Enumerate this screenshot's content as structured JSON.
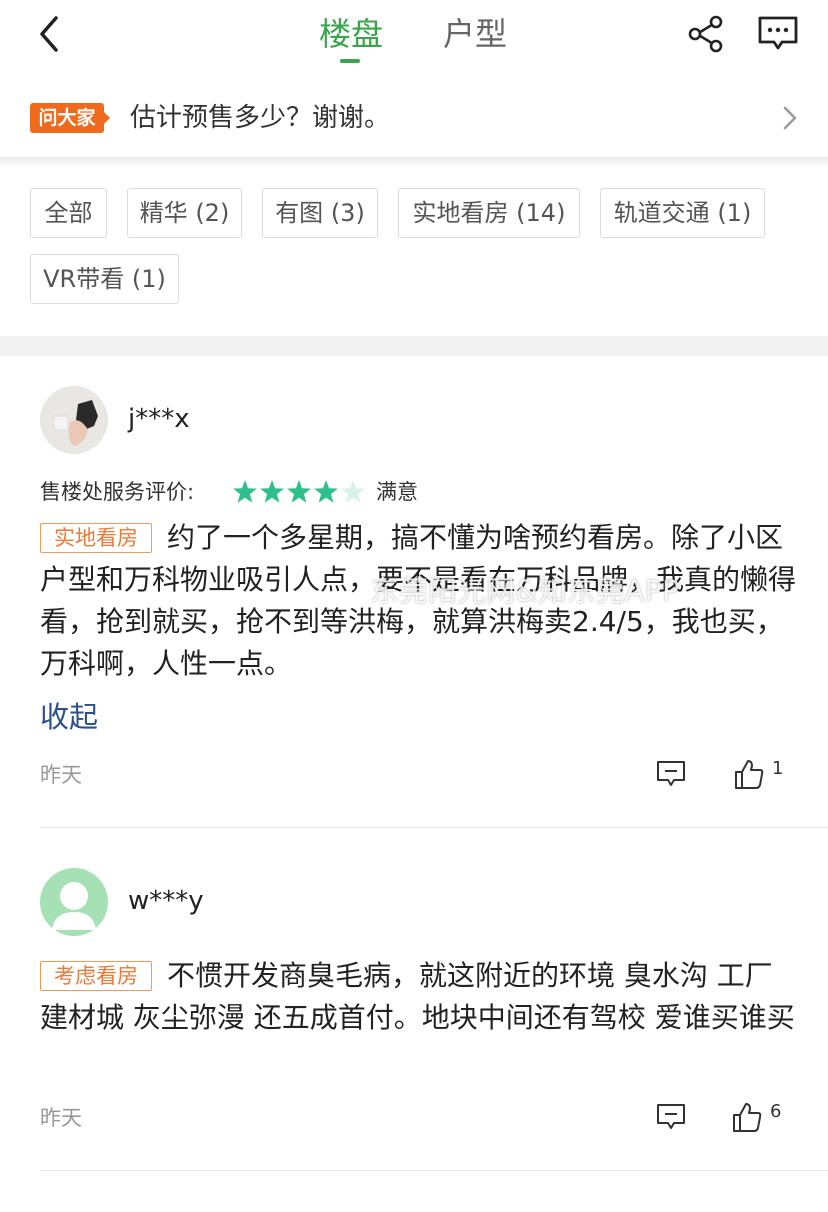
{
  "header": {
    "tabs": [
      {
        "label": "楼盘",
        "active": true
      },
      {
        "label": "户型",
        "active": false
      }
    ],
    "accent_color": "#3aa54a"
  },
  "ask": {
    "badge": "问大家",
    "question": "估计预售多少？谢谢。"
  },
  "filters": [
    "全部",
    "精华 (2)",
    "有图 (3)",
    "实地看房 (14)",
    "轨道交通 (1)",
    "VR带看 (1)"
  ],
  "reviews": [
    {
      "user": "j***x",
      "rating_label": "售楼处服务评价:",
      "rating": 4,
      "rating_max": 5,
      "rating_word": "满意",
      "tag": "实地看房",
      "text": "约了一个多星期，搞不懂为啥预约看房。除了小区户型和万科物业吸引人点，要不是看在万科品牌，我真的懒得看，抢到就买，抢不到等洪梅，就算洪梅卖2.4/5，我也买，万科啊，人性一点。",
      "collapse": "收起",
      "time": "昨天",
      "likes": "1"
    },
    {
      "user": "w***y",
      "tag": "考虑看房",
      "text": "不惯开发商臭毛病，就这附近的环境 臭水沟 工厂 建材城 灰尘弥漫 还五成首付。地块中间还有驾校   爱谁买谁买",
      "time": "昨天",
      "likes": "6"
    }
  ],
  "watermark": "东莞阳光网&知东莞APP"
}
